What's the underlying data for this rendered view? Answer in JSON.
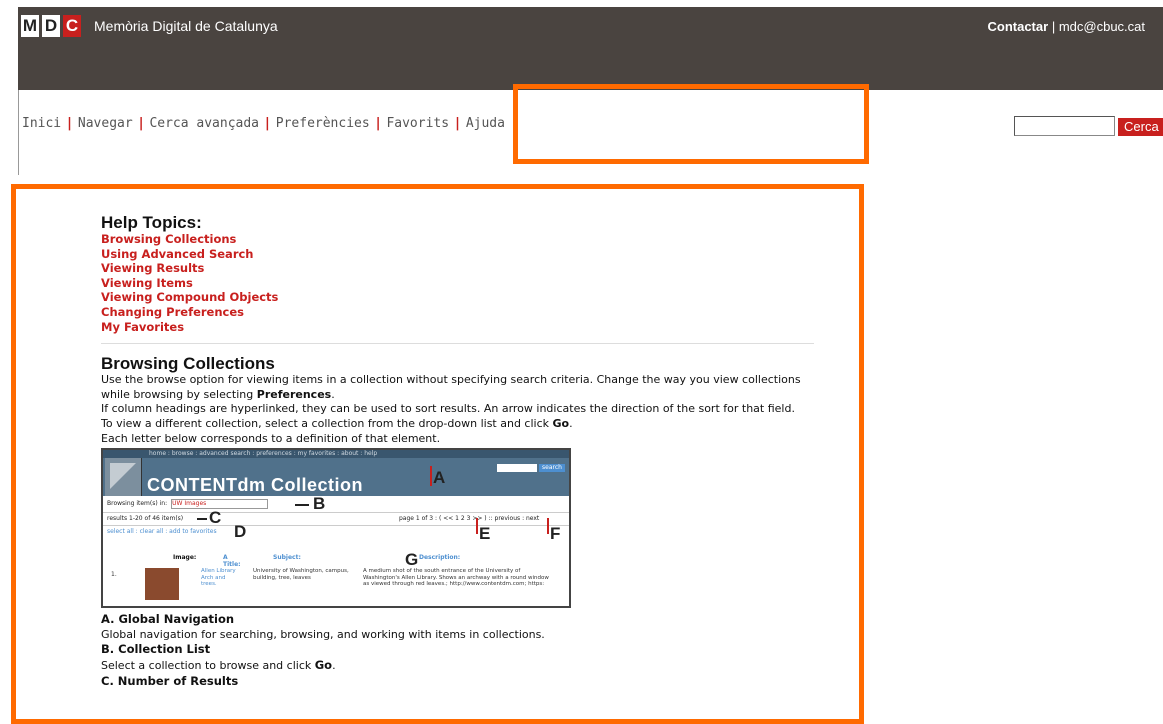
{
  "header": {
    "logo_letters": [
      "M",
      "D",
      "C"
    ],
    "site_name": "Memòria Digital de Catalunya",
    "contact_label": "Contactar",
    "contact_sep": "|",
    "email": "mdc@cbuc.cat"
  },
  "nav": {
    "items": [
      "Inici",
      "Navegar",
      "Cerca avançada",
      "Preferències",
      "Favorits",
      "Ajuda"
    ],
    "separator": "|"
  },
  "search": {
    "button_label": "Cerca"
  },
  "help": {
    "heading": "Help Topics:",
    "topics": [
      "Browsing Collections",
      "Using Advanced Search",
      "Viewing Results",
      "Viewing Items",
      "Viewing Compound Objects",
      "Changing Preferences",
      "My Favorites"
    ]
  },
  "browsing": {
    "heading": "Browsing Collections",
    "p1_start": "Use the browse option for viewing items in a collection without specifying search criteria. Change the way you view collections while browsing by selecting ",
    "p1_bold": "Preferences",
    "p1_end": ".",
    "p2": "If column headings are hyperlinked, they can be used to sort results. An arrow indicates the direction of the sort for that field.",
    "p3_start": "To view a different collection, select a collection from the drop-down list and click ",
    "p3_bold": "Go",
    "p3_end": ".",
    "p4": "Each letter below corresponds to a definition of that element."
  },
  "screenshot": {
    "topnav": "home : browse : advanced search : preferences : my favorites : about : help",
    "title": "CONTENTdm Collection",
    "search_btn": "search",
    "browse_label": "Browsing item(s) in:",
    "select_value": "UW Images",
    "results": "results 1-20 of 46 item(s)",
    "pagination": "page 1 of 3 : ( << 1 2 3 >> ) :: previous : next",
    "actions": "select all : clear all : add to favorites",
    "col_image": "Image:",
    "col_title": "A Title:",
    "col_subject": "Subject:",
    "col_desc": "Description:",
    "row_num": "1.",
    "row_title": "Allen Library Arch and trees.",
    "row_subject": "University of Washington, campus, building, tree, leaves",
    "row_desc": "A medium shot of the south entrance of the University of Washington's Allen Library. Shows an archway with a round window as viewed through red leaves.; http://www.contentdm.com; https:",
    "labels": [
      "A",
      "B",
      "C",
      "D",
      "E",
      "F",
      "G"
    ]
  },
  "definitions": [
    {
      "term": "A. Global Navigation",
      "desc": "Global navigation for searching, browsing, and working with items in collections."
    },
    {
      "term": "B. Collection List",
      "desc_start": "Select a collection to browse and click ",
      "desc_bold": "Go",
      "desc_end": "."
    },
    {
      "term": "C. Number of Results"
    }
  ],
  "colors": {
    "header_bg": "#4a4440",
    "accent_red": "#c8201e",
    "highlight_orange": "#ff6a00"
  }
}
